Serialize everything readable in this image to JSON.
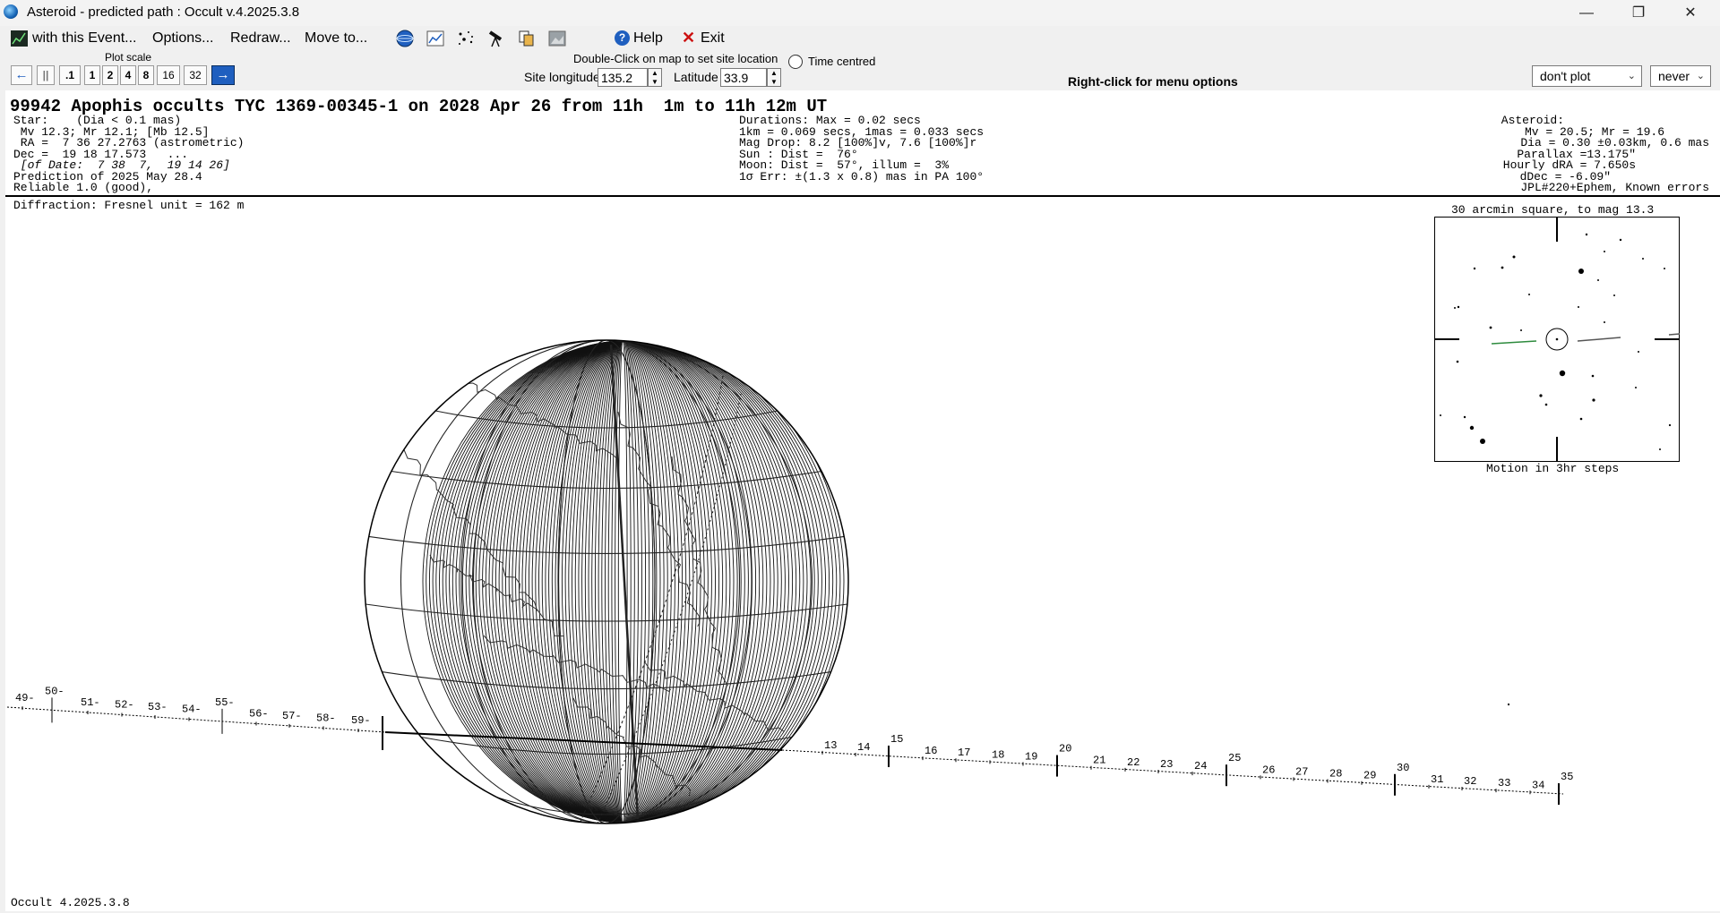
{
  "window": {
    "title": "Asteroid - predicted path : Occult v.4.2025.3.8",
    "minimize": "—",
    "maximize": "❐",
    "close": "✕"
  },
  "menu": {
    "with_event": "with this Event...",
    "options": "Options...",
    "redraw": "Redraw...",
    "move_to": "Move to...",
    "help": "Help",
    "exit": "Exit",
    "toolbar_icons": [
      "globe-icon",
      "chart-icon",
      "star-field-icon",
      "telescope-icon",
      "copy-icon",
      "image-icon"
    ]
  },
  "controls": {
    "plot_scale_label": "Plot scale",
    "scale_buttons": [
      ".1",
      "1",
      "2",
      "4",
      "8",
      "16",
      "32"
    ],
    "pause_label": "||",
    "dbl_click_hint": "Double-Click on map to set site location",
    "time_centred": "Time centred",
    "site_longitude_label": "Site longitude",
    "site_longitude": "135.2",
    "latitude_label": "Latitude",
    "latitude": "33.9",
    "right_click_hint": "Right-click for menu options",
    "plot_combo": "don't plot",
    "never_combo": "never"
  },
  "event": {
    "title": "99942 Apophis occults TYC 1369-00345-1 on 2028 Apr 26 from 11h  1m to 11h 12m UT",
    "star_block": [
      "Star:    (Dia < 0.1 mas)",
      " Mv 12.3; Mr 12.1; [Mb 12.5]",
      " RA =  7 36 27.2763 (astrometric)",
      "Dec =  19 18 17.573   ...",
      " [of Date:  7 38  7,  19 14 26]",
      "Prediction of 2025 May 28.4",
      "Reliable 1.0 (good),"
    ],
    "durations_block": [
      "Durations: Max = 0.02 secs",
      "1km = 0.069 secs, 1mas = 0.033 secs",
      "Mag Drop: 8.2 [100%]v, 7.6 [100%]r",
      "Sun : Dist =  76°",
      "Moon: Dist =  57°, illum =  3%",
      "1σ Err: ±(1.3 x 0.8) mas in PA 100°"
    ],
    "asteroid_block": [
      "Asteroid:",
      "Mv = 20.5; Mr = 19.6",
      "Dia = 0.30 ±0.03km, 0.6 mas",
      "Parallax =13.175\"",
      "Hourly dRA = 7.650s",
      "dDec = -6.09\"",
      "JPL#220+Ephem, Known errors"
    ],
    "diffraction": "Diffraction: Fresnel unit = 162 m",
    "finder_title": "30 arcmin square, to mag 13.3",
    "finder_caption": "Motion in 3hr steps",
    "footer_version": "Occult 4.2025.3.8"
  },
  "timeline": {
    "left_labels": [
      "49-",
      "50-",
      "51-",
      "52-",
      "53-",
      "54-",
      "55-",
      "56-",
      "57-",
      "58-",
      "59-"
    ],
    "right_labels": [
      "13",
      "14",
      "15",
      "16",
      "17",
      "18",
      "19",
      "20",
      "21",
      "22",
      "23",
      "24",
      "25",
      "26",
      "27",
      "28",
      "29",
      "30",
      "31",
      "32",
      "33",
      "34",
      "35"
    ]
  },
  "colors": {
    "accent": "#1f5fbf",
    "path_green": "#2e8b3e",
    "exit_red": "#cc1111"
  }
}
